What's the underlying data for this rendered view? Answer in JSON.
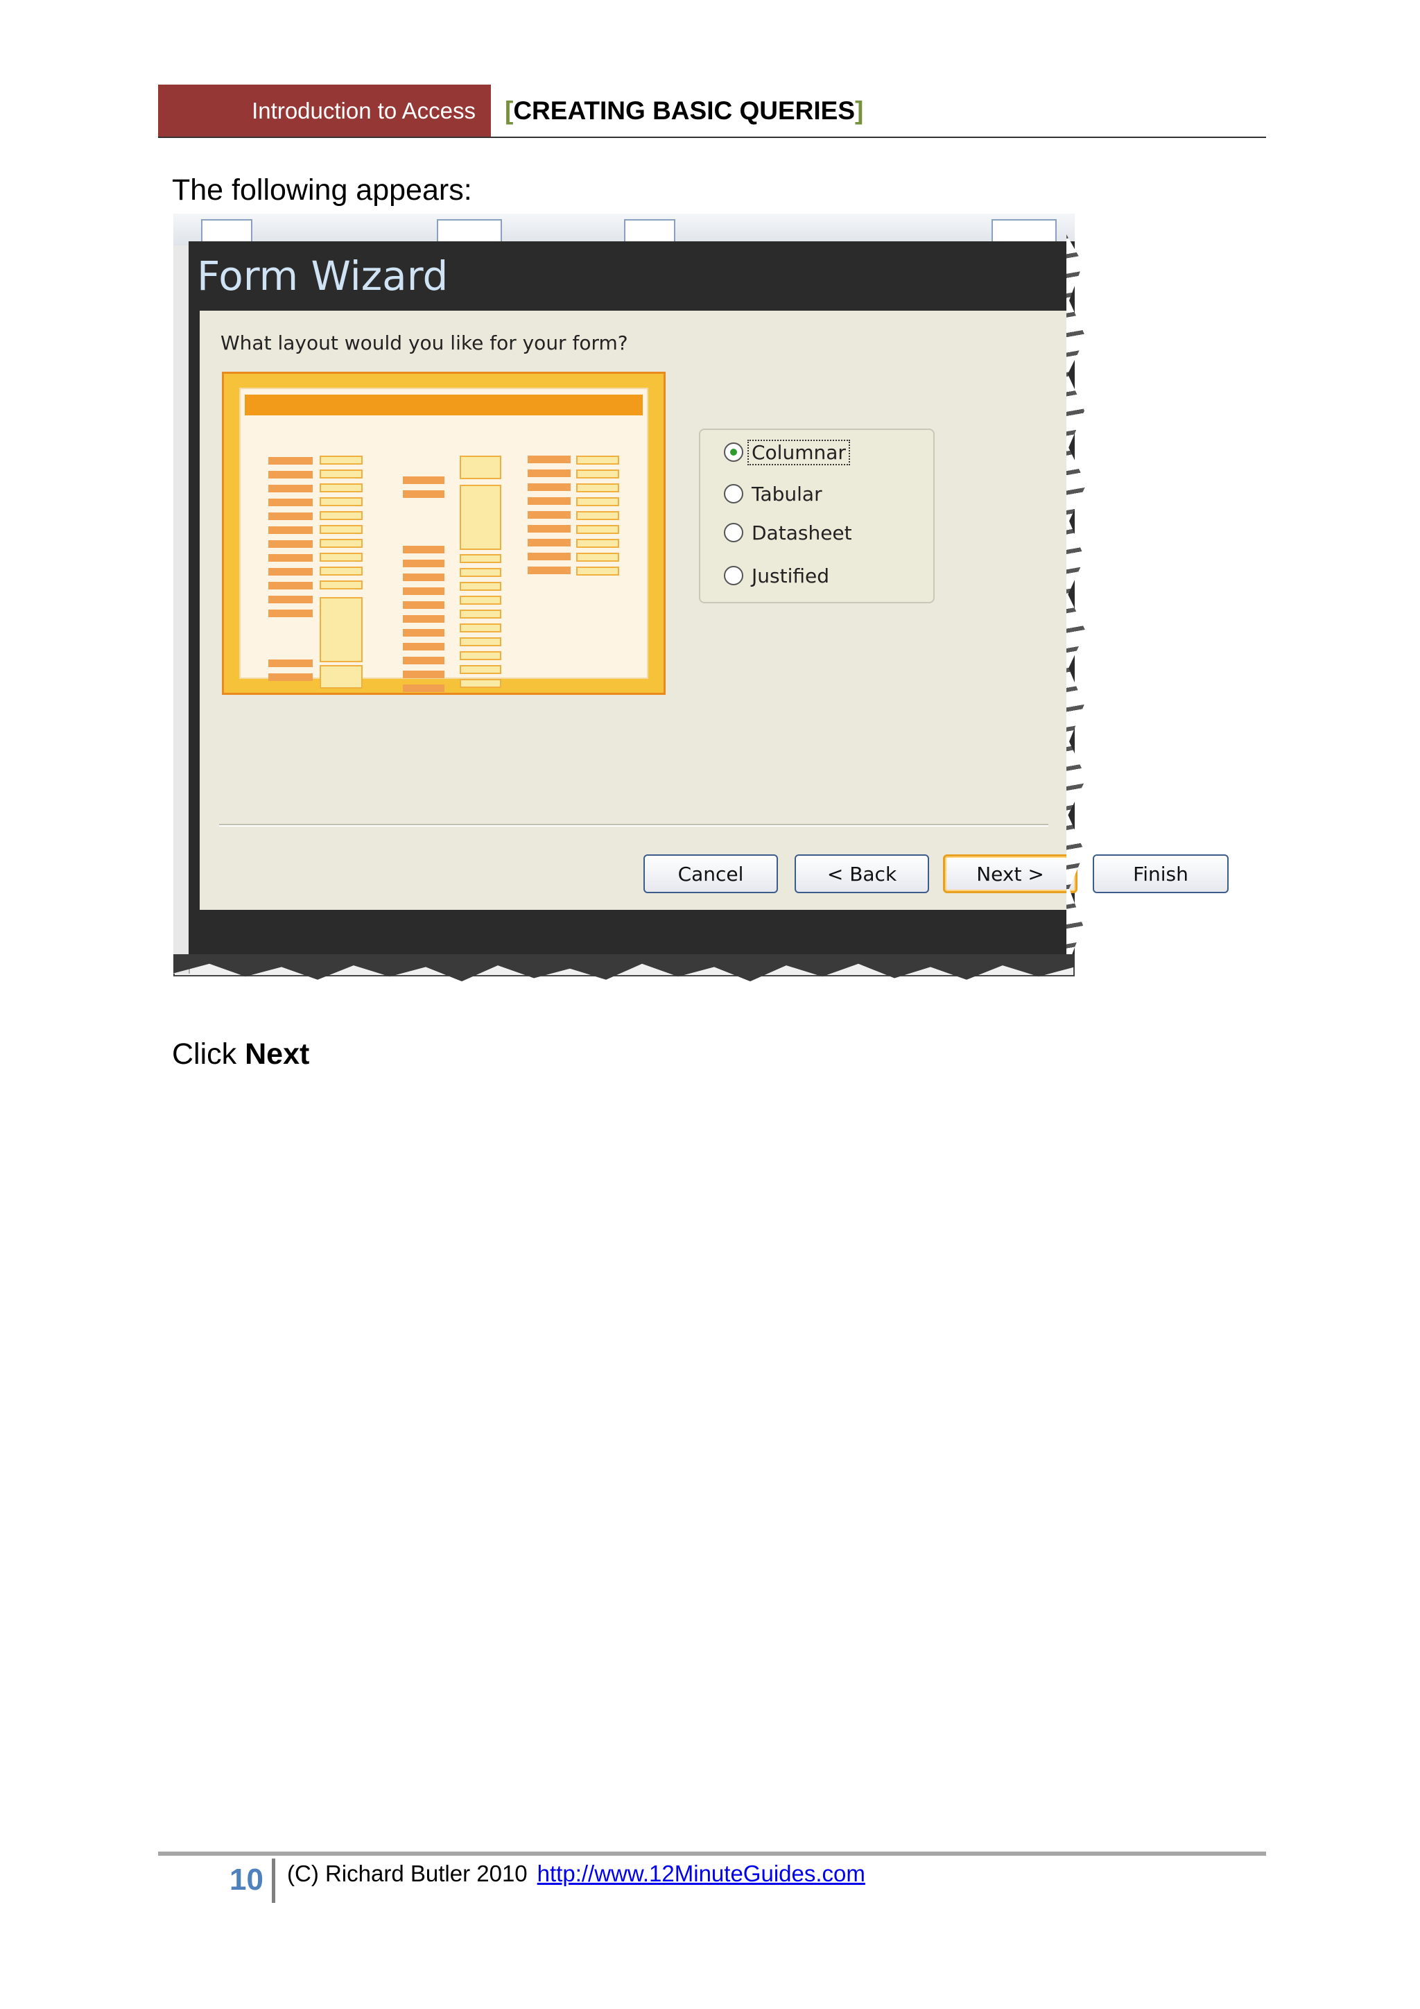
{
  "header": {
    "section": "Introduction to Access",
    "title_open": "[",
    "title": "CREATING BASIC QUERIES",
    "title_close": "]"
  },
  "body": {
    "intro": "The following appears:",
    "click_prefix": "Click ",
    "click_target": "Next"
  },
  "dialog": {
    "title": "Form Wizard",
    "question": "What layout would you like for your form?",
    "layouts": [
      {
        "label": "Columnar",
        "selected": true
      },
      {
        "label": "Tabular",
        "selected": false
      },
      {
        "label": "Datasheet",
        "selected": false
      },
      {
        "label": "Justified",
        "selected": false
      }
    ],
    "buttons": {
      "cancel": "Cancel",
      "back": "< Back",
      "next": "Next >",
      "finish": "Finish"
    }
  },
  "footer": {
    "page_number": "10",
    "copyright": "(C) Richard Butler 2010",
    "link": "http://www.12MinuteGuides.com"
  },
  "colors": {
    "header_red": "#953735",
    "bracket_green": "#76923c",
    "page_number_blue": "#4f81bd",
    "preview_orange": "#f29a1a"
  }
}
